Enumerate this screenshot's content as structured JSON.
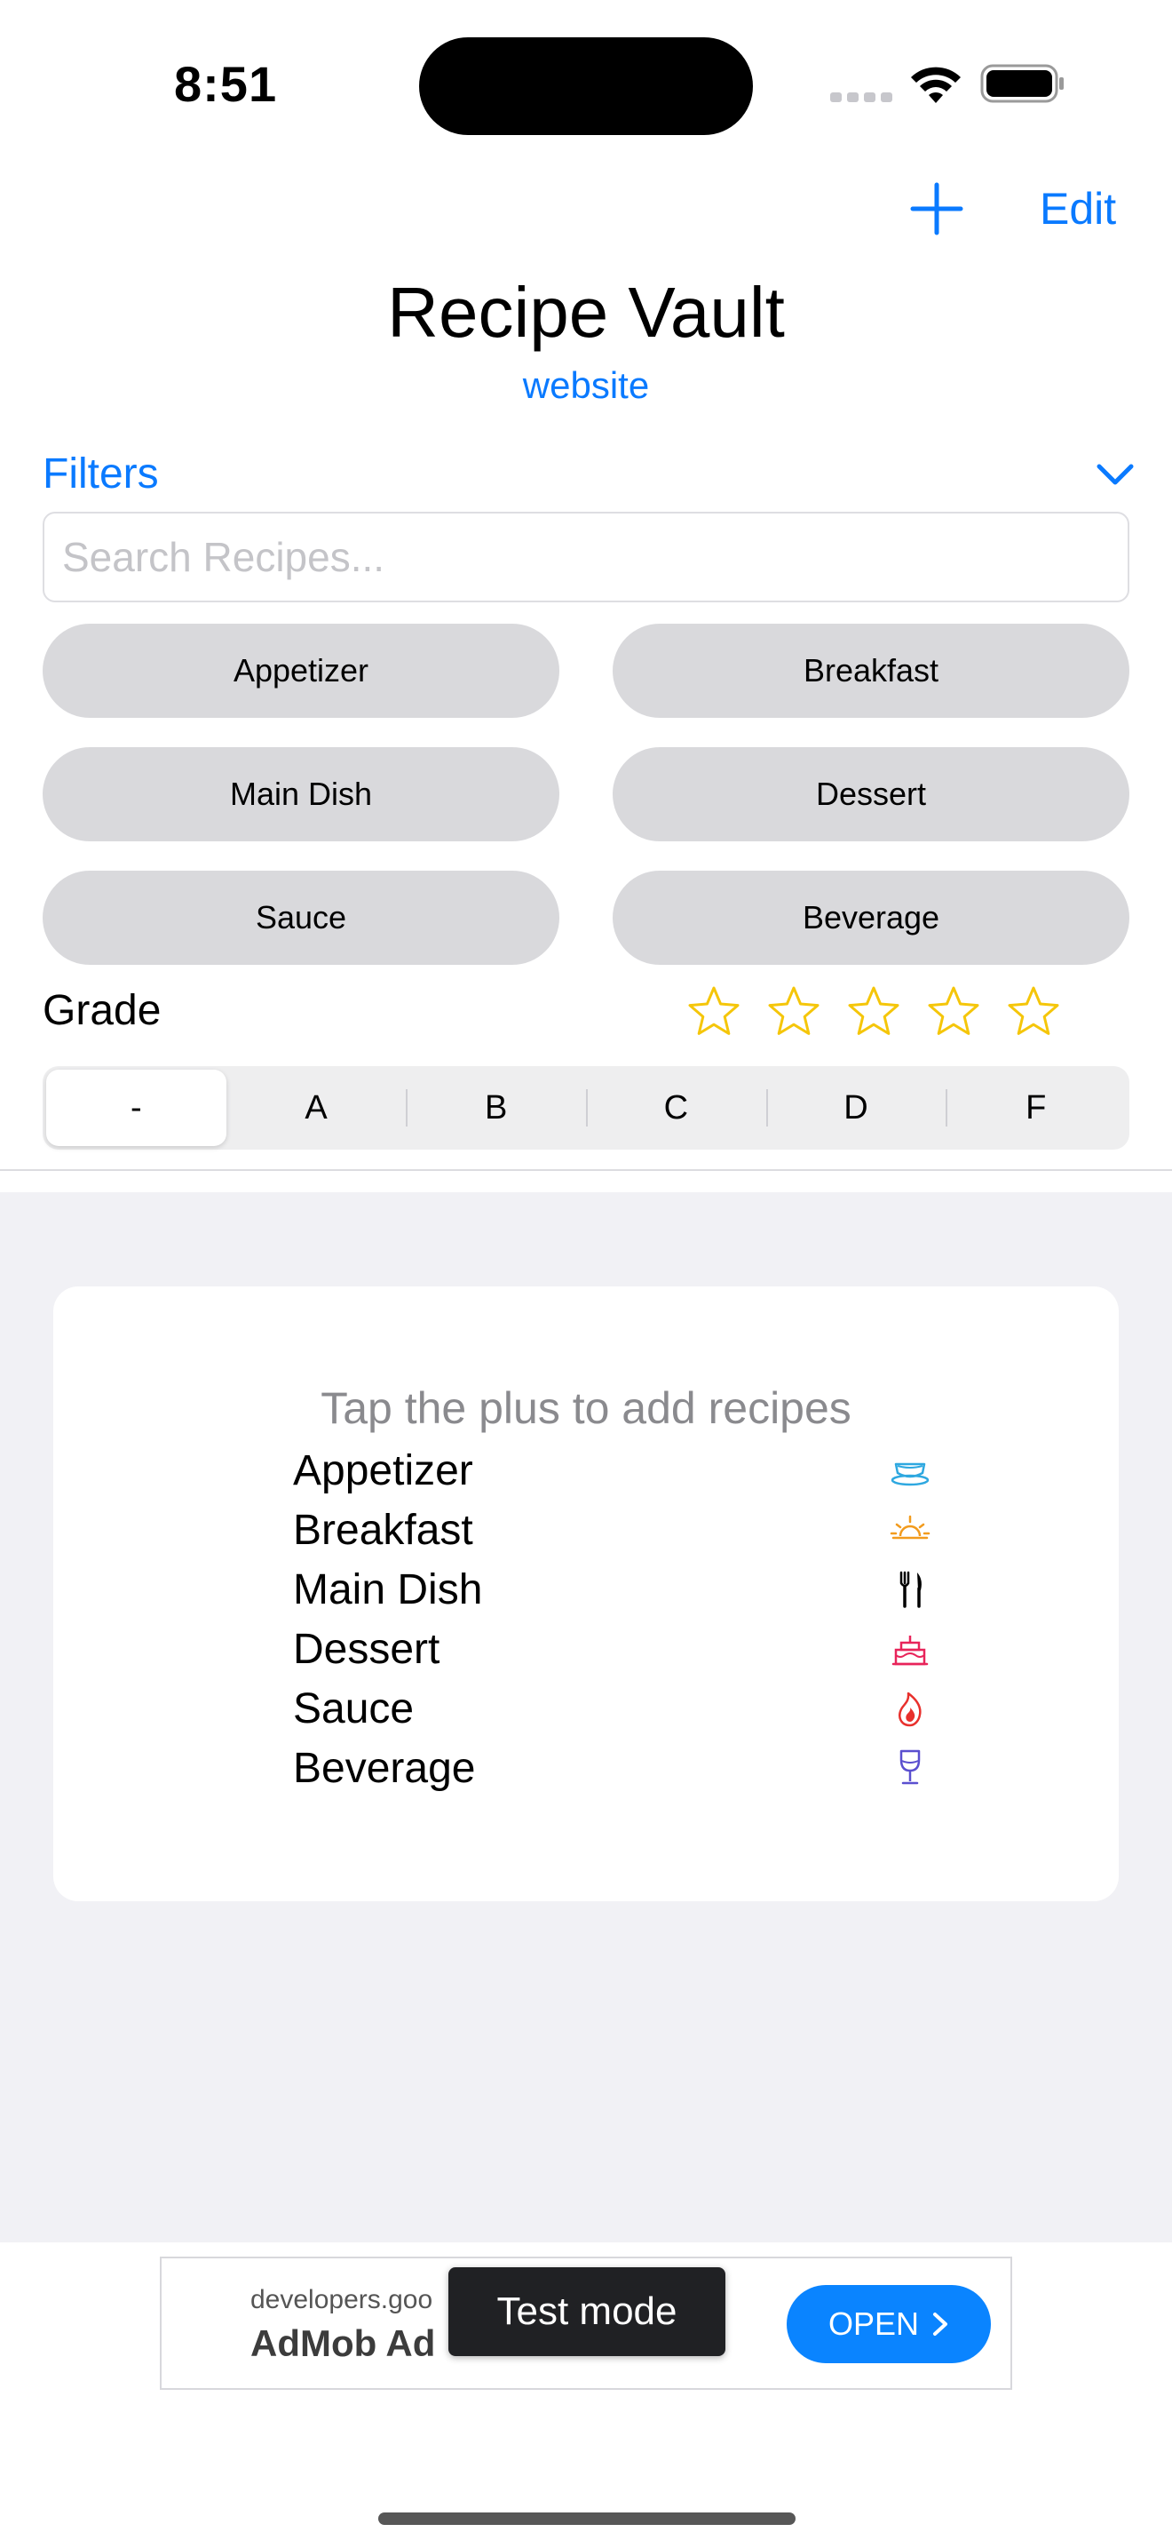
{
  "status_bar": {
    "time": "8:51"
  },
  "nav": {
    "edit_label": "Edit",
    "plus_icon": "plus-icon"
  },
  "header": {
    "title": "Recipe Vault",
    "link": "website"
  },
  "filters": {
    "label": "Filters",
    "search_placeholder": "Search Recipes...",
    "categories": [
      "Appetizer",
      "Breakfast",
      "Main Dish",
      "Dessert",
      "Sauce",
      "Beverage"
    ],
    "grade_label": "Grade",
    "star_rating": 0,
    "star_max": 5,
    "grades": [
      "-",
      "A",
      "B",
      "C",
      "D",
      "F"
    ],
    "selected_grade": "-"
  },
  "empty_state": {
    "hint": "Tap the plus to add recipes",
    "legend": [
      {
        "label": "Appetizer",
        "icon": "cup-saucer-icon",
        "color": "#2ea8e0"
      },
      {
        "label": "Breakfast",
        "icon": "sunrise-icon",
        "color": "#f29b1d"
      },
      {
        "label": "Main Dish",
        "icon": "fork-knife-icon",
        "color": "#000000"
      },
      {
        "label": "Dessert",
        "icon": "birthday-cake-icon",
        "color": "#e8245a"
      },
      {
        "label": "Sauce",
        "icon": "flame-icon",
        "color": "#e8302c"
      },
      {
        "label": "Beverage",
        "icon": "wineglass-icon",
        "color": "#5a4fcf"
      }
    ]
  },
  "ad": {
    "url": "developers.goo",
    "title": "AdMob Ad",
    "open_label": "OPEN",
    "test_mode": "Test mode"
  },
  "colors": {
    "accent": "#0a7aff",
    "star": "#f5c60a",
    "ad_button": "#0a84ff"
  }
}
